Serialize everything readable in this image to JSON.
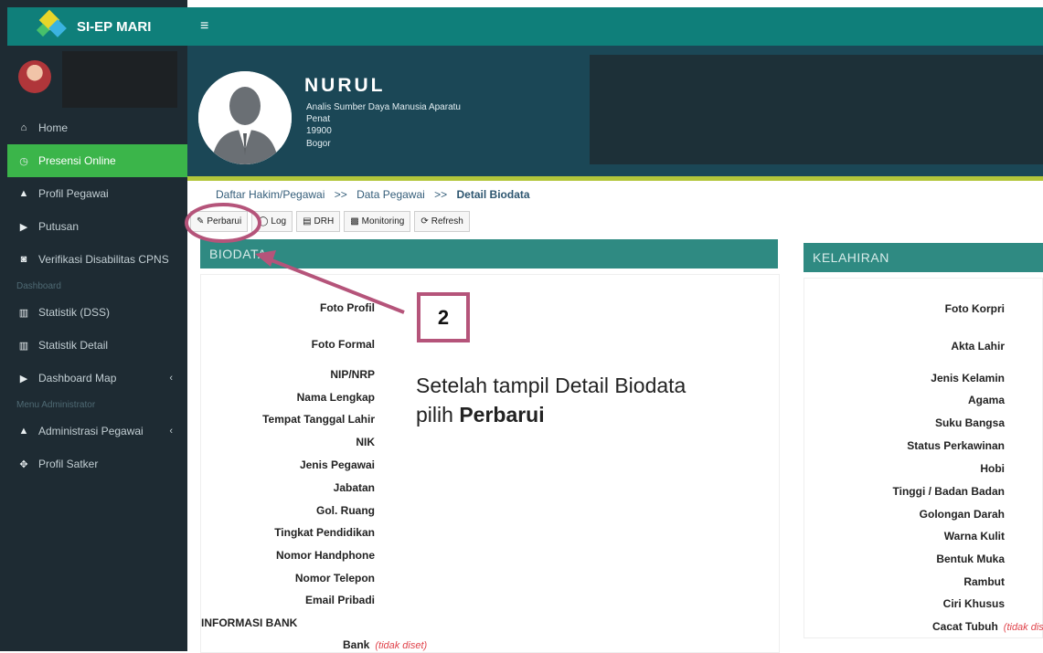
{
  "app": {
    "brand": "SI-EP MARI"
  },
  "sidebar": {
    "items": [
      {
        "icon": "home-icon",
        "glyph": "⌂",
        "label": "Home"
      },
      {
        "icon": "clock-icon",
        "glyph": "◷",
        "label": "Presensi Online"
      },
      {
        "icon": "user-icon",
        "glyph": "▲",
        "label": "Profil Pegawai"
      },
      {
        "icon": "flag-icon",
        "glyph": "▶",
        "label": "Putusan"
      },
      {
        "icon": "wheelchair-icon",
        "glyph": "◙",
        "label": "Verifikasi Disabilitas CPNS"
      }
    ],
    "header_dashboard": "Dashboard",
    "dash_items": [
      {
        "icon": "bar-chart-icon",
        "glyph": "▥",
        "label": "Statistik (DSS)"
      },
      {
        "icon": "bar-chart-icon",
        "glyph": "▥",
        "label": "Statistik Detail"
      },
      {
        "icon": "flag-icon",
        "glyph": "▶",
        "label": "Dashboard Map",
        "caret": "‹"
      }
    ],
    "header_admin": "Menu Administrator",
    "admin_items": [
      {
        "icon": "user-icon",
        "glyph": "▲",
        "label": "Administrasi Pegawai",
        "caret": "‹"
      },
      {
        "icon": "building-icon",
        "glyph": "✥",
        "label": "Profil Satker"
      }
    ]
  },
  "profile": {
    "name": "NURUL",
    "position": "Analis Sumber Daya Manusia Aparatu",
    "rank": "Penat",
    "nip": "19900",
    "location": "Bogor"
  },
  "breadcrumb": {
    "item1": "Daftar Hakim/Pegawai",
    "sep": ">>",
    "item2": "Data Pegawai",
    "current": "Detail Biodata"
  },
  "toolbar": {
    "perbarui": "Perbarui",
    "log": "Log",
    "drh": "DRH",
    "monitoring": "Monitoring",
    "refresh": "Refresh"
  },
  "biodata": {
    "title": "BIODATA",
    "fields": [
      "Foto Profil",
      "Foto Formal",
      "NIP/NRP",
      "Nama Lengkap",
      "Tempat Tanggal Lahir",
      "NIK",
      "Jenis Pegawai",
      "Jabatan",
      "Gol. Ruang",
      "Tingkat Pendidikan",
      "Nomor Handphone",
      "Nomor Telepon",
      "Email Pribadi"
    ],
    "section_bank": "INFORMASI BANK",
    "bank_label": "Bank",
    "bank_value": "(tidak diset)"
  },
  "kelahiran": {
    "title": "KELAHIRAN",
    "fields": [
      "Foto Korpri",
      "Akta Lahir",
      "Jenis Kelamin",
      "Agama",
      "Suku Bangsa",
      "Status Perkawinan",
      "Hobi",
      "Tinggi / Badan Badan",
      "Golongan Darah",
      "Warna Kulit",
      "Bentuk Muka",
      "Rambut",
      "Ciri Khusus"
    ],
    "cacat_label": "Cacat Tubuh",
    "cacat_value": "(tidak diset)"
  },
  "annotation": {
    "step": "2",
    "line1": "Setelah tampil Detail Biodata",
    "line2_prefix": "pilih ",
    "line2_bold": "Perbarui",
    "color": "#b5547a"
  }
}
